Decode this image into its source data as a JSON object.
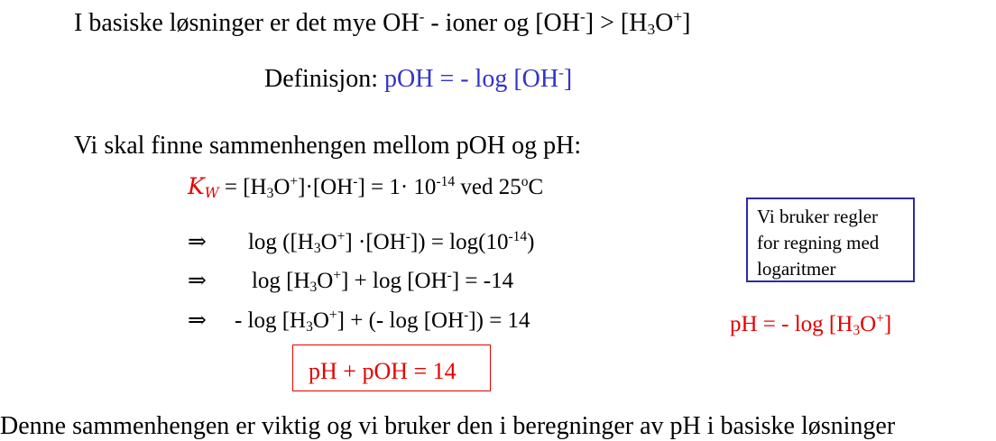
{
  "line1": {
    "a": "I basiske løsninger er det mye OH",
    "b": "-",
    "c": " - ioner og [OH",
    "d": "-",
    "e": "] > [H",
    "f": "3",
    "g": "O",
    "h": "+",
    "i": "]"
  },
  "definition": {
    "label": "Definisjon: ",
    "formula": "pOH = - log [OH",
    "sup": "-",
    "end": "]"
  },
  "intro": "Vi skal finne sammenhengen mellom pOH og pH:",
  "kw": {
    "symbol": "K",
    "symbol_sub": "W",
    "a": " = [H",
    "b": "3",
    "c": "O",
    "d": "+",
    "e": "]·[OH",
    "f": "-",
    "g": "] = 1·  10",
    "h": "-14",
    "i": "      ved 25",
    "j": "o",
    "k": "C"
  },
  "step1": {
    "arrow": "⇒",
    "a": "log ([H",
    "b": "3",
    "c": "O",
    "d": "+",
    "e": "] ·[OH",
    "f": "-",
    "g": "]) = log(10",
    "h": "-14",
    "i": ")"
  },
  "step2": {
    "arrow": "⇒",
    "a": "log [H",
    "b": "3",
    "c": "O",
    "d": "+",
    "e": "] + log [OH",
    "f": "-",
    "g": "] = -14"
  },
  "step3": {
    "arrow": "⇒",
    "a": "- log [H",
    "b": "3",
    "c": "O",
    "d": "+",
    "e": "] + (- log [OH",
    "f": "-",
    "g": "]) = 14"
  },
  "result": "pH + pOH = 14",
  "note_lines": [
    "Vi bruker regler",
    "for regning med",
    "logaritmer"
  ],
  "ph_def": {
    "a": "pH =  - log [H",
    "b": "3",
    "c": "O",
    "d": "+",
    "e": "]"
  },
  "conclusion": "Denne sammenhengen er viktig og vi bruker den i beregninger av pH i basiske løsninger",
  "colors": {
    "blue": "#3333cc",
    "red": "#e60000",
    "box_blue_border": "#2b2ba8"
  }
}
